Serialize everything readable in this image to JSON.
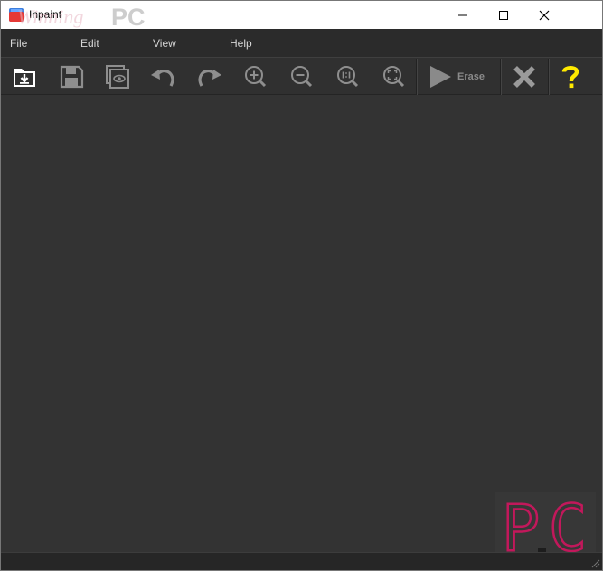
{
  "window": {
    "title": "Inpaint",
    "watermark_text_left": "Winning",
    "watermark_text_right": "PC"
  },
  "menu": {
    "file": "File",
    "edit": "Edit",
    "view": "View",
    "help": "Help"
  },
  "toolbar": {
    "erase_label": "Erase",
    "icons": {
      "open": "open-file-icon",
      "save": "save-icon",
      "preview": "preview-icon",
      "undo": "undo-icon",
      "redo": "redo-icon",
      "zoom_in": "zoom-in-icon",
      "zoom_out": "zoom-out-icon",
      "zoom_actual": "zoom-actual-size-icon",
      "zoom_fit": "zoom-fit-icon",
      "erase": "play-icon",
      "cancel": "close-x-icon",
      "help": "question-mark-icon"
    }
  },
  "colors": {
    "canvas": "#333333",
    "toolbar": "#303030",
    "menubar": "#2b2b2b",
    "icon_gray": "#9a9a9a",
    "help_yellow": "#ffea00",
    "watermark_pink": "#c2185b"
  },
  "watermark_corner": {
    "letter_left": "P",
    "letter_right": "C"
  }
}
